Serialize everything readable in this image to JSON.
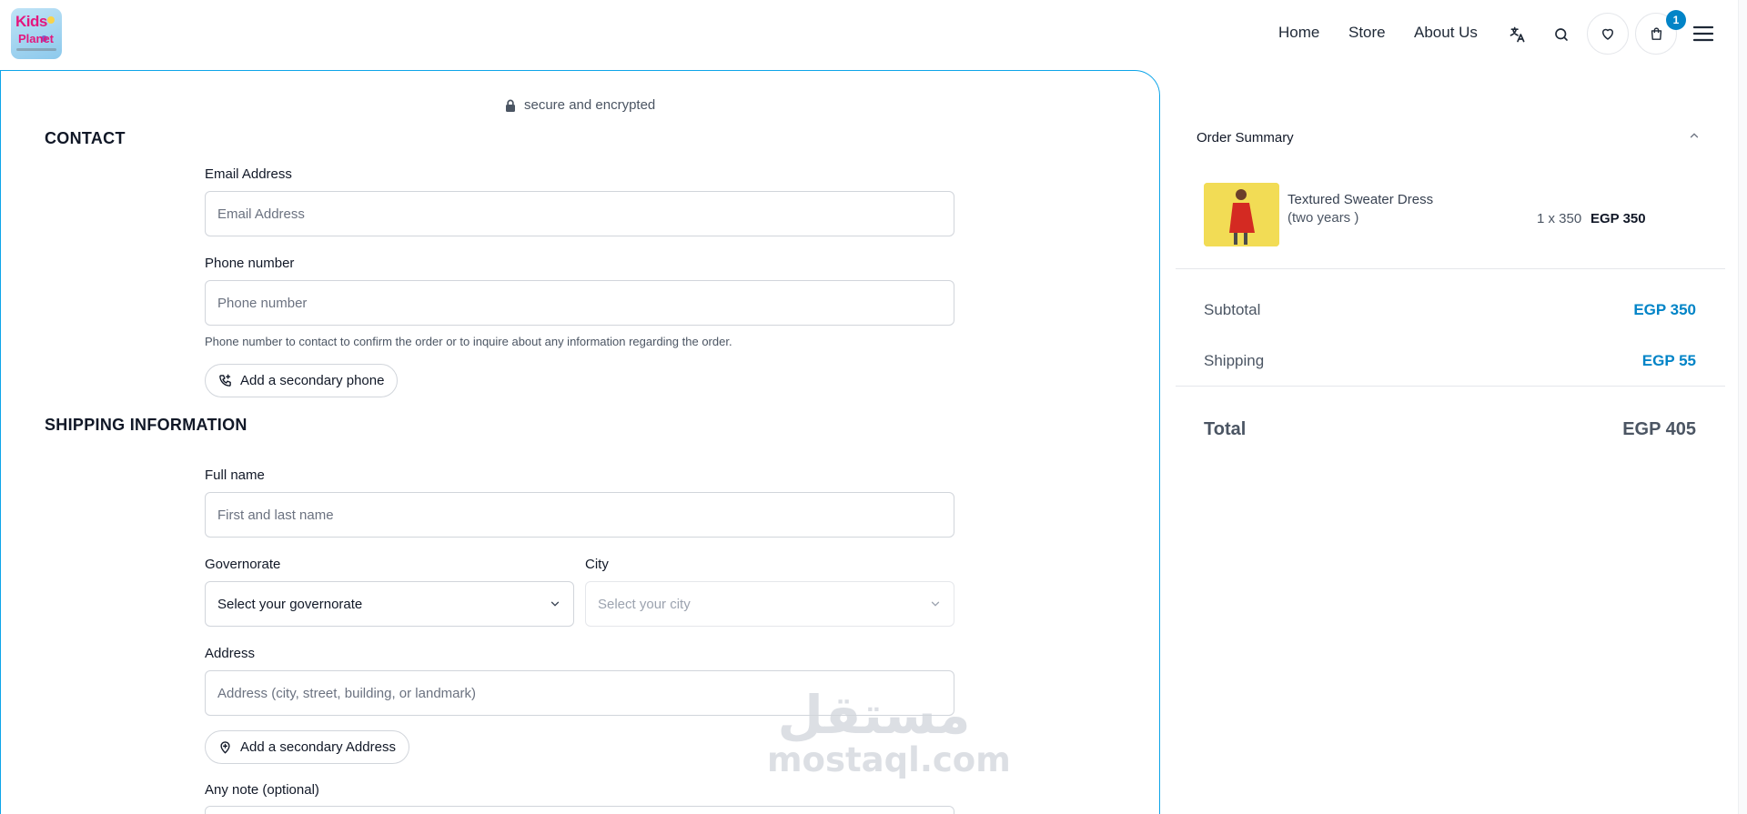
{
  "header": {
    "logo_line1": "Kids",
    "logo_line2": "Planet",
    "nav": [
      "Home",
      "Store",
      "About Us"
    ],
    "cart_count": "1",
    "icons": [
      "translate-icon",
      "search-icon",
      "heart-icon",
      "cart-icon",
      "menu-icon"
    ]
  },
  "secure_text": "secure and encrypted",
  "contact": {
    "title": "CONTACT",
    "email_label": "Email Address",
    "email_placeholder": "Email Address",
    "phone_label": "Phone number",
    "phone_placeholder": "Phone number",
    "phone_hint": "Phone number to contact to confirm the order or to inquire about any information regarding the order.",
    "secondary_phone_button": "Add a secondary phone"
  },
  "shipping": {
    "title": "SHIPPING INFORMATION",
    "name_label": "Full name",
    "name_placeholder": "First and last name",
    "governorate_label": "Governorate",
    "governorate_value": "Select your governorate",
    "city_label": "City",
    "city_value": "Select your city",
    "address_label": "Address",
    "address_placeholder": "Address (city, street, building, or landmark)",
    "secondary_address_button": "Add a secondary Address",
    "note_label": "Any note (optional)"
  },
  "watermark": {
    "arabic": "مستقل",
    "latin": "mostaql.com"
  },
  "summary": {
    "title": "Order Summary",
    "item": {
      "name": "Textured Sweater Dress",
      "variant": "(two years )",
      "qty": "1 x 350",
      "total": "EGP 350"
    },
    "subtotal_label": "Subtotal",
    "subtotal_value": "EGP 350",
    "shipping_label": "Shipping",
    "shipping_value": "EGP 55",
    "total_label": "Total",
    "total_value": "EGP 405"
  },
  "colors": {
    "accent": "#0284c7",
    "card_border": "#0ea5e9",
    "brand_pink": "#e4177e"
  }
}
